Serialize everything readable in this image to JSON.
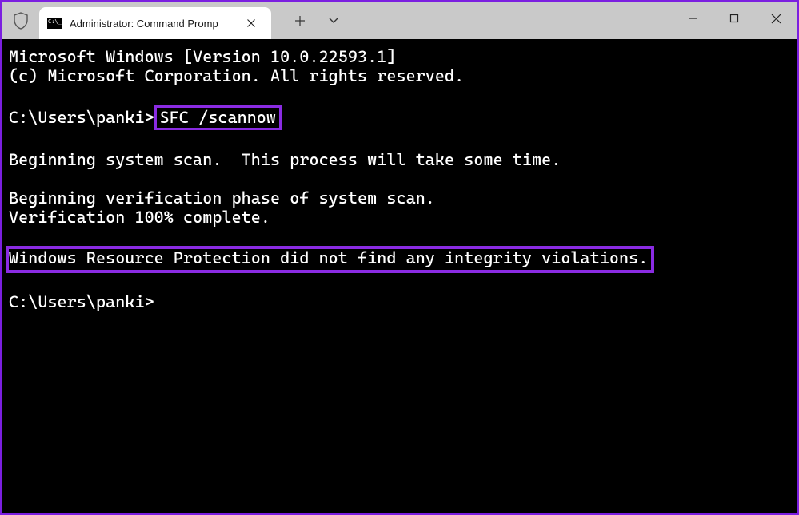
{
  "window": {
    "tab_title": "Administrator: Command Promp"
  },
  "terminal": {
    "line_version": "Microsoft Windows [Version 10.0.22593.1]",
    "line_copyright": "(c) Microsoft Corporation. All rights reserved.",
    "prompt1_prefix": "C:\\Users\\panki>",
    "command1": "SFC /scannow",
    "line_beginning": "Beginning system scan.  This process will take some time.",
    "line_verify1": "Beginning verification phase of system scan.",
    "line_verify2": "Verification 100% complete.",
    "line_result": "Windows Resource Protection did not find any integrity violations.",
    "prompt2": "C:\\Users\\panki>"
  }
}
